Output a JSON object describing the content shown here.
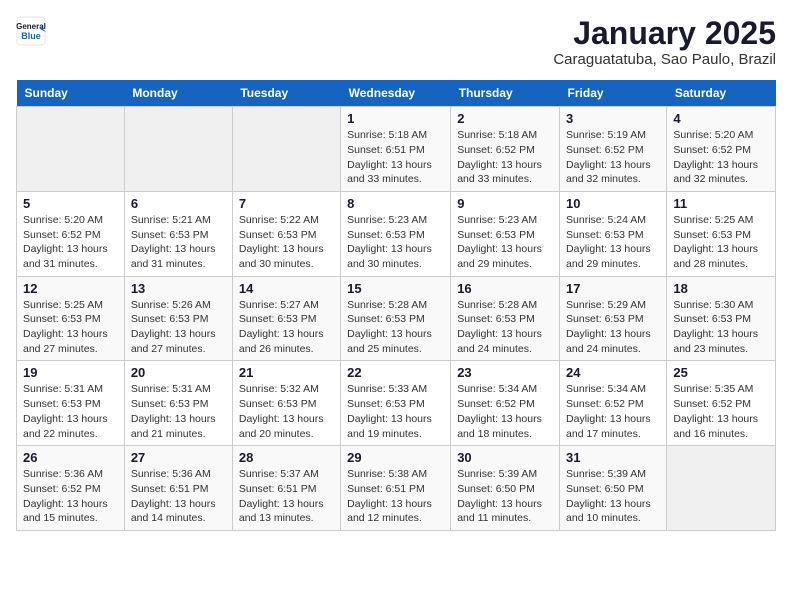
{
  "header": {
    "logo_general": "General",
    "logo_blue": "Blue",
    "month": "January 2025",
    "location": "Caraguatatuba, Sao Paulo, Brazil"
  },
  "weekdays": [
    "Sunday",
    "Monday",
    "Tuesday",
    "Wednesday",
    "Thursday",
    "Friday",
    "Saturday"
  ],
  "weeks": [
    [
      {
        "date": "",
        "info": ""
      },
      {
        "date": "",
        "info": ""
      },
      {
        "date": "",
        "info": ""
      },
      {
        "date": "1",
        "info": "Sunrise: 5:18 AM\nSunset: 6:51 PM\nDaylight: 13 hours\nand 33 minutes."
      },
      {
        "date": "2",
        "info": "Sunrise: 5:18 AM\nSunset: 6:52 PM\nDaylight: 13 hours\nand 33 minutes."
      },
      {
        "date": "3",
        "info": "Sunrise: 5:19 AM\nSunset: 6:52 PM\nDaylight: 13 hours\nand 32 minutes."
      },
      {
        "date": "4",
        "info": "Sunrise: 5:20 AM\nSunset: 6:52 PM\nDaylight: 13 hours\nand 32 minutes."
      }
    ],
    [
      {
        "date": "5",
        "info": "Sunrise: 5:20 AM\nSunset: 6:52 PM\nDaylight: 13 hours\nand 31 minutes."
      },
      {
        "date": "6",
        "info": "Sunrise: 5:21 AM\nSunset: 6:53 PM\nDaylight: 13 hours\nand 31 minutes."
      },
      {
        "date": "7",
        "info": "Sunrise: 5:22 AM\nSunset: 6:53 PM\nDaylight: 13 hours\nand 30 minutes."
      },
      {
        "date": "8",
        "info": "Sunrise: 5:23 AM\nSunset: 6:53 PM\nDaylight: 13 hours\nand 30 minutes."
      },
      {
        "date": "9",
        "info": "Sunrise: 5:23 AM\nSunset: 6:53 PM\nDaylight: 13 hours\nand 29 minutes."
      },
      {
        "date": "10",
        "info": "Sunrise: 5:24 AM\nSunset: 6:53 PM\nDaylight: 13 hours\nand 29 minutes."
      },
      {
        "date": "11",
        "info": "Sunrise: 5:25 AM\nSunset: 6:53 PM\nDaylight: 13 hours\nand 28 minutes."
      }
    ],
    [
      {
        "date": "12",
        "info": "Sunrise: 5:25 AM\nSunset: 6:53 PM\nDaylight: 13 hours\nand 27 minutes."
      },
      {
        "date": "13",
        "info": "Sunrise: 5:26 AM\nSunset: 6:53 PM\nDaylight: 13 hours\nand 27 minutes."
      },
      {
        "date": "14",
        "info": "Sunrise: 5:27 AM\nSunset: 6:53 PM\nDaylight: 13 hours\nand 26 minutes."
      },
      {
        "date": "15",
        "info": "Sunrise: 5:28 AM\nSunset: 6:53 PM\nDaylight: 13 hours\nand 25 minutes."
      },
      {
        "date": "16",
        "info": "Sunrise: 5:28 AM\nSunset: 6:53 PM\nDaylight: 13 hours\nand 24 minutes."
      },
      {
        "date": "17",
        "info": "Sunrise: 5:29 AM\nSunset: 6:53 PM\nDaylight: 13 hours\nand 24 minutes."
      },
      {
        "date": "18",
        "info": "Sunrise: 5:30 AM\nSunset: 6:53 PM\nDaylight: 13 hours\nand 23 minutes."
      }
    ],
    [
      {
        "date": "19",
        "info": "Sunrise: 5:31 AM\nSunset: 6:53 PM\nDaylight: 13 hours\nand 22 minutes."
      },
      {
        "date": "20",
        "info": "Sunrise: 5:31 AM\nSunset: 6:53 PM\nDaylight: 13 hours\nand 21 minutes."
      },
      {
        "date": "21",
        "info": "Sunrise: 5:32 AM\nSunset: 6:53 PM\nDaylight: 13 hours\nand 20 minutes."
      },
      {
        "date": "22",
        "info": "Sunrise: 5:33 AM\nSunset: 6:53 PM\nDaylight: 13 hours\nand 19 minutes."
      },
      {
        "date": "23",
        "info": "Sunrise: 5:34 AM\nSunset: 6:52 PM\nDaylight: 13 hours\nand 18 minutes."
      },
      {
        "date": "24",
        "info": "Sunrise: 5:34 AM\nSunset: 6:52 PM\nDaylight: 13 hours\nand 17 minutes."
      },
      {
        "date": "25",
        "info": "Sunrise: 5:35 AM\nSunset: 6:52 PM\nDaylight: 13 hours\nand 16 minutes."
      }
    ],
    [
      {
        "date": "26",
        "info": "Sunrise: 5:36 AM\nSunset: 6:52 PM\nDaylight: 13 hours\nand 15 minutes."
      },
      {
        "date": "27",
        "info": "Sunrise: 5:36 AM\nSunset: 6:51 PM\nDaylight: 13 hours\nand 14 minutes."
      },
      {
        "date": "28",
        "info": "Sunrise: 5:37 AM\nSunset: 6:51 PM\nDaylight: 13 hours\nand 13 minutes."
      },
      {
        "date": "29",
        "info": "Sunrise: 5:38 AM\nSunset: 6:51 PM\nDaylight: 13 hours\nand 12 minutes."
      },
      {
        "date": "30",
        "info": "Sunrise: 5:39 AM\nSunset: 6:50 PM\nDaylight: 13 hours\nand 11 minutes."
      },
      {
        "date": "31",
        "info": "Sunrise: 5:39 AM\nSunset: 6:50 PM\nDaylight: 13 hours\nand 10 minutes."
      },
      {
        "date": "",
        "info": ""
      }
    ]
  ]
}
